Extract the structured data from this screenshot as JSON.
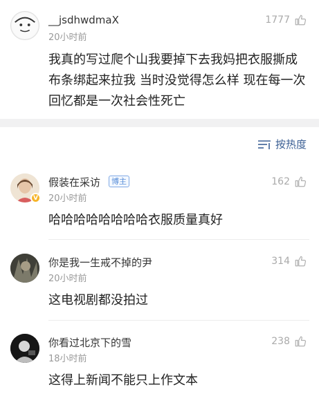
{
  "comments": [
    {
      "username": "__jsdhwdmaX",
      "time": "20小时前",
      "likes": "1777",
      "text": "我真的写过爬个山我要掉下去我妈把衣服撕成布条绑起来拉我 当时没觉得怎么样 现在每一次回忆都是一次社会性死亡"
    },
    {
      "username": "假装在采访",
      "badge": "博主",
      "time": "20小时前",
      "likes": "162",
      "text": "哈哈哈哈哈哈哈哈衣服质量真好"
    },
    {
      "username": "你是我一生戒不掉的尹",
      "time": "20小时前",
      "likes": "314",
      "text": "这电视剧都没拍过"
    },
    {
      "username": "你看过北京下的雪",
      "time": "18小时前",
      "likes": "238",
      "text": "这得上新闻不能只上作文本"
    }
  ],
  "sort": {
    "label": "按热度",
    "icon": "sort-icon"
  },
  "icons": {
    "like": "thumbs-up-icon"
  },
  "colors": {
    "link": "#3b5f94",
    "meta": "#999999",
    "band": "#f1f1f2",
    "badge": "#5b8fd8"
  }
}
